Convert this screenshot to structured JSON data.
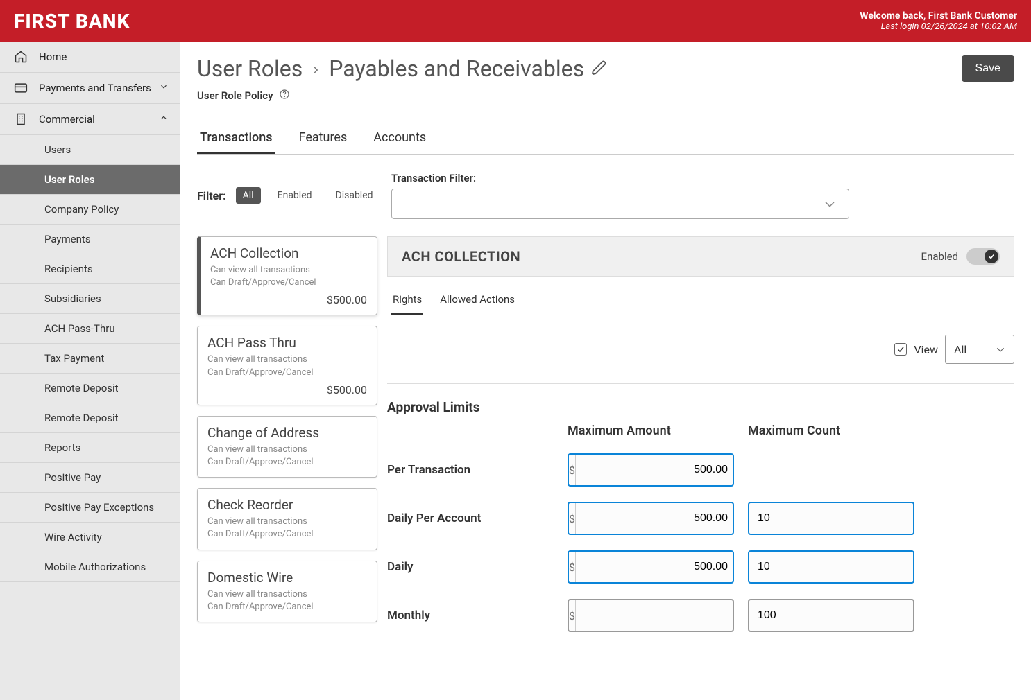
{
  "header": {
    "logo": "FIRST BANK",
    "welcome_line1": "Welcome back, First Bank Customer",
    "welcome_line2": "Last login 02/26/2024 at 10:02 AM"
  },
  "sidebar": {
    "home": "Home",
    "payments": "Payments and Transfers",
    "commercial": "Commercial",
    "sub": {
      "users": "Users",
      "user_roles": "User Roles",
      "company_policy": "Company Policy",
      "payments": "Payments",
      "recipients": "Recipients",
      "subsidiaries": "Subsidiaries",
      "ach_pass_thru": "ACH Pass-Thru",
      "tax_payment": "Tax Payment",
      "remote_deposit1": "Remote Deposit",
      "remote_deposit2": "Remote Deposit",
      "reports": "Reports",
      "positive_pay": "Positive Pay",
      "positive_pay_exceptions": "Positive Pay Exceptions",
      "wire_activity": "Wire Activity",
      "mobile_authorizations": "Mobile Authorizations"
    }
  },
  "breadcrumb": {
    "root": "User Roles",
    "current": "Payables and Receivables"
  },
  "save_label": "Save",
  "subhead": "User Role Policy",
  "tabs": {
    "transactions": "Transactions",
    "features": "Features",
    "accounts": "Accounts"
  },
  "filter": {
    "label": "Filter:",
    "all": "All",
    "enabled": "Enabled",
    "disabled": "Disabled",
    "tx_label": "Transaction Filter:"
  },
  "tx_list": [
    {
      "title": "ACH Collection",
      "meta1": "Can view all transactions",
      "meta2": "Can Draft/Approve/Cancel",
      "amount": "$500.00"
    },
    {
      "title": "ACH Pass Thru",
      "meta1": "Can view all transactions",
      "meta2": "Can Draft/Approve/Cancel",
      "amount": "$500.00"
    },
    {
      "title": "Change of Address",
      "meta1": "Can view all transactions",
      "meta2": "Can Draft/Approve/Cancel",
      "amount": ""
    },
    {
      "title": "Check Reorder",
      "meta1": "Can view all transactions",
      "meta2": "Can Draft/Approve/Cancel",
      "amount": ""
    },
    {
      "title": "Domestic Wire",
      "meta1": "Can view all transactions",
      "meta2": "Can Draft/Approve/Cancel",
      "amount": ""
    }
  ],
  "detail": {
    "title": "ACH COLLECTION",
    "enabled_label": "Enabled",
    "subtabs": {
      "rights": "Rights",
      "allowed": "Allowed Actions"
    },
    "view_label": "View",
    "view_select": "All",
    "approval_title": "Approval Limits",
    "col_amount": "Maximum Amount",
    "col_count": "Maximum Count",
    "currency": "$",
    "rows": {
      "per_tx": {
        "label": "Per Transaction",
        "amount": "500.00",
        "count": ""
      },
      "daily_acct": {
        "label": "Daily Per Account",
        "amount": "500.00",
        "count": "10"
      },
      "daily": {
        "label": "Daily",
        "amount": "500.00",
        "count": "10"
      },
      "monthly": {
        "label": "Monthly",
        "amount": "",
        "count": "100"
      }
    }
  }
}
